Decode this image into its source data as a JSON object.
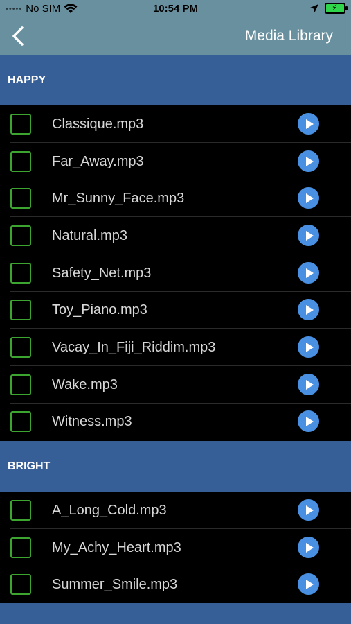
{
  "status": {
    "carrier": "No SIM",
    "time": "10:54 PM"
  },
  "nav": {
    "title": "Media Library"
  },
  "sections": [
    {
      "title": "HAPPY",
      "items": [
        "Classique.mp3",
        "Far_Away.mp3",
        "Mr_Sunny_Face.mp3",
        "Natural.mp3",
        "Safety_Net.mp3",
        "Toy_Piano.mp3",
        "Vacay_In_Fiji_Riddim.mp3",
        "Wake.mp3",
        "Witness.mp3"
      ]
    },
    {
      "title": "BRIGHT",
      "items": [
        "A_Long_Cold.mp3",
        "My_Achy_Heart.mp3",
        "Summer_Smile.mp3"
      ]
    }
  ],
  "colors": {
    "bar": "#69909f",
    "section_header": "#365f97",
    "checkbox_border": "#3ba52f",
    "play_button": "#4a90e2"
  }
}
